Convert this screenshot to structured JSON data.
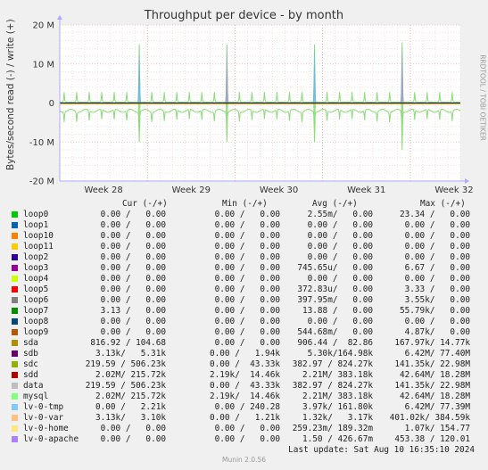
{
  "title": "Throughput per device - by month",
  "ylabel": "Bytes/second read (-) / write (+)",
  "rrdtool_label": "RRDTOOL / TOBI OETIKER",
  "munin_version": "Munin 2.0.56",
  "last_update": "Last update: Sat Aug 10 16:35:10 2024",
  "legend_headers": {
    "cur": "Cur (-/+)",
    "min": "Min (-/+)",
    "avg": "Avg (-/+)",
    "max": "Max (-/+)"
  },
  "chart_data": {
    "type": "line",
    "title": "Throughput per device - by month",
    "ylabel": "Bytes/second read (-) / write (+)",
    "ylim": [
      -20000000,
      20000000
    ],
    "yticks": [
      {
        "value": 20000000,
        "label": "20 M"
      },
      {
        "value": 10000000,
        "label": "10 M"
      },
      {
        "value": 0,
        "label": "0"
      },
      {
        "value": -10000000,
        "label": "-10 M"
      },
      {
        "value": -20000000,
        "label": "-20 M"
      }
    ],
    "xlim": [
      0,
      32
    ],
    "xticks": [
      {
        "value": 3.5,
        "label": "Week 28"
      },
      {
        "value": 10.5,
        "label": "Week 29"
      },
      {
        "value": 17.5,
        "label": "Week 30"
      },
      {
        "value": 24.5,
        "label": "Week 31"
      },
      {
        "value": 31.5,
        "label": "Week 32"
      }
    ],
    "grid": true,
    "weekly_spikes": {
      "days": [
        6,
        13,
        20,
        27
      ],
      "write_peaks": [
        15000000,
        15000000,
        15000000,
        15500000
      ],
      "read_troughs": [
        -10000000,
        -10000000,
        -10000000,
        -12000000
      ],
      "colors": [
        "#66B3E6",
        "#9999CC"
      ]
    },
    "daily_pattern": {
      "write_peak": 2500000,
      "read_level": -2000000,
      "read_trough": -4500000,
      "color": "#88DD77"
    }
  },
  "legend": [
    {
      "name": "loop0",
      "color": "#00CC00",
      "cur": "0.00 /   0.00",
      "min": "0.00 /   0.00",
      "avg": "2.55m/   0.00",
      "max": "23.34 /   0.00"
    },
    {
      "name": "loop1",
      "color": "#0066B3",
      "cur": "0.00 /   0.00",
      "min": "0.00 /   0.00",
      "avg": "0.00 /   0.00",
      "max": "0.00 /   0.00"
    },
    {
      "name": "loop10",
      "color": "#FF8000",
      "cur": "0.00 /   0.00",
      "min": "0.00 /   0.00",
      "avg": "0.00 /   0.00",
      "max": "0.00 /   0.00"
    },
    {
      "name": "loop11",
      "color": "#FFCC00",
      "cur": "0.00 /   0.00",
      "min": "0.00 /   0.00",
      "avg": "0.00 /   0.00",
      "max": "0.00 /   0.00"
    },
    {
      "name": "loop2",
      "color": "#330099",
      "cur": "0.00 /   0.00",
      "min": "0.00 /   0.00",
      "avg": "0.00 /   0.00",
      "max": "0.00 /   0.00"
    },
    {
      "name": "loop3",
      "color": "#990099",
      "cur": "0.00 /   0.00",
      "min": "0.00 /   0.00",
      "avg": "745.65u/   0.00",
      "max": "6.67 /   0.00"
    },
    {
      "name": "loop4",
      "color": "#CCFF00",
      "cur": "0.00 /   0.00",
      "min": "0.00 /   0.00",
      "avg": "0.00 /   0.00",
      "max": "0.00 /   0.00"
    },
    {
      "name": "loop5",
      "color": "#FF0000",
      "cur": "0.00 /   0.00",
      "min": "0.00 /   0.00",
      "avg": "372.83u/   0.00",
      "max": "3.33 /   0.00"
    },
    {
      "name": "loop6",
      "color": "#808080",
      "cur": "0.00 /   0.00",
      "min": "0.00 /   0.00",
      "avg": "397.95m/   0.00",
      "max": "3.55k/   0.00"
    },
    {
      "name": "loop7",
      "color": "#008F00",
      "cur": "3.13 /   0.00",
      "min": "0.00 /   0.00",
      "avg": "13.88 /   0.00",
      "max": "55.79k/   0.00"
    },
    {
      "name": "loop8",
      "color": "#00487D",
      "cur": "0.00 /   0.00",
      "min": "0.00 /   0.00",
      "avg": "0.00 /   0.00",
      "max": "0.00 /   0.00"
    },
    {
      "name": "loop9",
      "color": "#B35A00",
      "cur": "0.00 /   0.00",
      "min": "0.00 /   0.00",
      "avg": "544.68m/   0.00",
      "max": "4.87k/   0.00"
    },
    {
      "name": "sda",
      "color": "#B38F00",
      "cur": "816.92 / 104.68",
      "min": "0.00 /   0.00",
      "avg": "906.44 /  82.86",
      "max": "167.97k/ 14.77k"
    },
    {
      "name": "sdb",
      "color": "#6B006B",
      "cur": "3.13k/   5.31k",
      "min": "0.00 /   1.94k",
      "avg": "5.30k/164.98k",
      "max": "6.42M/ 77.40M"
    },
    {
      "name": "sdc",
      "color": "#8FB300",
      "cur": "219.59 / 506.23k",
      "min": "0.00 /  43.33k",
      "avg": "382.97 / 824.27k",
      "max": "141.35k/ 22.98M"
    },
    {
      "name": "sdd",
      "color": "#B30000",
      "cur": "2.02M/ 215.72k",
      "min": "2.19k/  14.46k",
      "avg": "2.21M/ 383.18k",
      "max": "42.64M/ 18.28M"
    },
    {
      "name": "data",
      "color": "#BEBEBE",
      "cur": "219.59 / 506.23k",
      "min": "0.00 /  43.33k",
      "avg": "382.97 / 824.27k",
      "max": "141.35k/ 22.98M"
    },
    {
      "name": "mysql",
      "color": "#80FF80",
      "cur": "2.02M/ 215.72k",
      "min": "2.19k/  14.46k",
      "avg": "2.21M/ 383.18k",
      "max": "42.64M/ 18.28M"
    },
    {
      "name": "lv-0-tmp",
      "color": "#80C9FF",
      "cur": "0.00 /   2.21k",
      "min": "0.00 / 240.28",
      "avg": "3.97k/ 161.80k",
      "max": "6.42M/ 77.39M"
    },
    {
      "name": "lv-0-var",
      "color": "#FFC080",
      "cur": "3.13k/   3.10k",
      "min": "0.00 /   1.21k",
      "avg": "1.32k/   3.17k",
      "max": "401.02k/ 384.59k"
    },
    {
      "name": "lv-0-home",
      "color": "#FFE680",
      "cur": "0.00 /   0.00",
      "min": "0.00 /   0.00",
      "avg": "259.23m/ 189.32m",
      "max": "1.07k/ 154.77"
    },
    {
      "name": "lv-0-apache",
      "color": "#AA80FF",
      "cur": "0.00 /   0.00",
      "min": "0.00 /   0.00",
      "avg": "1.50 / 426.67m",
      "max": "453.38 / 120.01"
    }
  ]
}
